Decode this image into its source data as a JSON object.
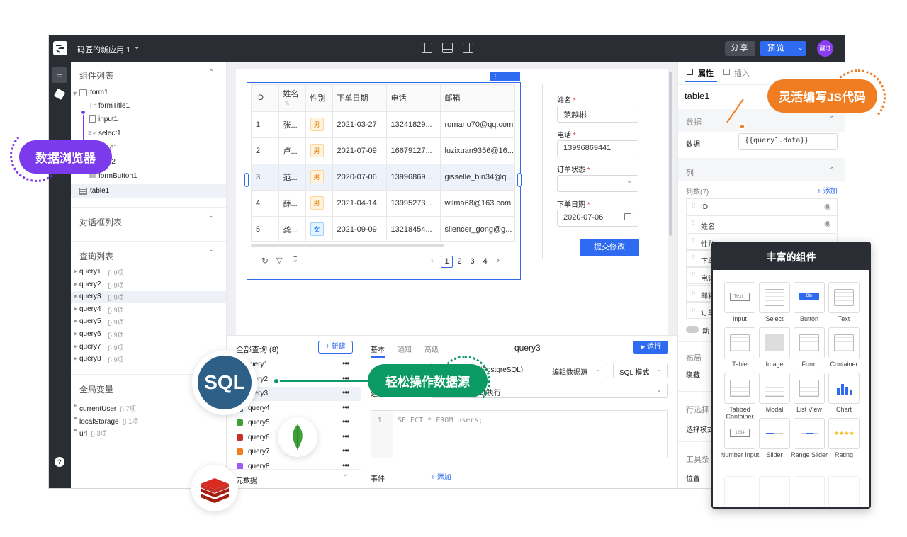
{
  "topbar": {
    "app_name": "码匠的新应用 1",
    "share_label": "分享",
    "preview_label": "预览",
    "avatar_text": "醒汀"
  },
  "leftpanel": {
    "components_title": "组件列表",
    "tree": [
      {
        "label": "form1"
      },
      {
        "label": "formTitle1"
      },
      {
        "label": "input1"
      },
      {
        "label": "select1"
      },
      {
        "label": "input2"
      },
      {
        "label": "input3"
      },
      {
        "label": "formButton1"
      },
      {
        "label": "table1"
      }
    ],
    "tree_visible_suffix": {
      "input2": "e1",
      "input3": "ut2"
    },
    "dialogs_title": "对话框列表",
    "queries_title": "查询列表",
    "queries": [
      {
        "name": "query1",
        "meta": "{} 9项"
      },
      {
        "name": "query2",
        "meta": "{} 9项"
      },
      {
        "name": "query3",
        "meta": "{} 9项"
      },
      {
        "name": "query4",
        "meta": "{} 9项"
      },
      {
        "name": "query5",
        "meta": "{} 9项"
      },
      {
        "name": "query6",
        "meta": "{} 9项"
      },
      {
        "name": "query7",
        "meta": "{} 9项"
      },
      {
        "name": "query8",
        "meta": "{} 9项"
      }
    ],
    "globals_title": "全局变量",
    "globals": [
      {
        "name": "currentUser",
        "meta": "{} 7项"
      },
      {
        "name": "localStorage",
        "meta": "{} 1项"
      },
      {
        "name": "url",
        "meta": "{} 3项"
      }
    ]
  },
  "table": {
    "badge": "table1",
    "headers": [
      "ID",
      "姓名",
      "性别",
      "下单日期",
      "电话",
      "邮箱"
    ],
    "rows": [
      [
        "1",
        "张...",
        "男",
        "2021-03-27",
        "13241829...",
        "romario70@qq.com"
      ],
      [
        "2",
        "卢...",
        "男",
        "2021-07-09",
        "16679127...",
        "luzixuan9356@16..."
      ],
      [
        "3",
        "范...",
        "男",
        "2020-07-06",
        "13996869...",
        "gisselle_bin34@q..."
      ],
      [
        "4",
        "薛...",
        "男",
        "2021-04-14",
        "13995273...",
        "wilma68@163.com"
      ],
      [
        "5",
        "龚...",
        "女",
        "2021-09-09",
        "13218454...",
        "silencer_gong@g..."
      ]
    ],
    "pages": [
      "1",
      "2",
      "3",
      "4"
    ]
  },
  "form": {
    "name_label": "姓名",
    "name_value": "范越彬",
    "phone_label": "电话",
    "phone_value": "13996869441",
    "status_label": "订单状态",
    "date_label": "下单日期",
    "date_value": "2020-07-06",
    "submit_label": "提交修改",
    "required_mark": "*"
  },
  "querypanel": {
    "all_title": "全部查询 (8)",
    "new_label": "+ 新建",
    "items": [
      "query1",
      "query2",
      "query3",
      "query4",
      "query5",
      "query6",
      "query7",
      "query8"
    ],
    "visible_items": [
      "uery1",
      "uery2",
      "uery3",
      "query4",
      "query5",
      "query6",
      "query7",
      "query8"
    ],
    "meta_label": "元数据",
    "tabs": [
      "基本",
      "通知",
      "高级"
    ],
    "current_query": "query3",
    "run_label": "运行",
    "datasource_text": "(PostgreSQL)",
    "edit_ds_label": "编辑数据源",
    "mode_label": "SQL 模式",
    "trigger_text": "动执行",
    "line_no": "1",
    "sql": "SELECT * FROM users;",
    "events_label": "事件",
    "add_label": "+ 添加",
    "row_label_cut": "选"
  },
  "rightpanel": {
    "tab_props": "属性",
    "tab_insert": "插入",
    "component_name": "table1",
    "data_section": "数据",
    "data_label": "数据",
    "data_value": "{{query1.data}}",
    "columns_section": "列",
    "columns_count_label": "列数(7)",
    "add_label": "+ 添加",
    "columns": [
      "ID",
      "姓名",
      "性别",
      "下单",
      "电话",
      "邮箱",
      "订单"
    ],
    "columns_visible": [
      "ID",
      "姓名",
      "性别",
      "下单",
      "电话",
      "邮箱",
      "订单"
    ],
    "dynamic_label": "动",
    "layout_section": "布局",
    "hidden_label": "隐藏",
    "rowselect_section": "行选择",
    "select_mode_label": "选择模式",
    "toolbar_section": "工具条",
    "position_label": "位置"
  },
  "callouts": {
    "data_browser": "数据浏览器",
    "js_code": "灵活编写JS代码",
    "datasource": "轻松操作数据源",
    "sql_badge": "SQL"
  },
  "components_popup": {
    "title": "丰富的组件",
    "items": [
      {
        "label": "Input",
        "icon": "input-icon"
      },
      {
        "label": "Select",
        "icon": "select-icon"
      },
      {
        "label": "Button",
        "icon": "button-icon"
      },
      {
        "label": "Text",
        "icon": "text-icon"
      },
      {
        "label": "Table",
        "icon": "table-icon"
      },
      {
        "label": "Image",
        "icon": "image-icon"
      },
      {
        "label": "Form",
        "icon": "form-icon"
      },
      {
        "label": "Container",
        "icon": "container-icon"
      },
      {
        "label": "Tabbed Container",
        "icon": "tabbed-container-icon"
      },
      {
        "label": "Modal",
        "icon": "modal-icon"
      },
      {
        "label": "List View",
        "icon": "list-view-icon"
      },
      {
        "label": "Chart",
        "icon": "chart-icon"
      },
      {
        "label": "Number Input",
        "icon": "number-input-icon"
      },
      {
        "label": "Slider",
        "icon": "slider-icon"
      },
      {
        "label": "Range Slider",
        "icon": "range-slider-icon"
      },
      {
        "label": "Rating",
        "icon": "rating-icon"
      }
    ],
    "card_texts": {
      "input": "Text",
      "button": "Btn",
      "number": "1234"
    }
  },
  "colors": {
    "accent": "#2f6bf0",
    "purple": "#7c3aed",
    "orange": "#f07d22",
    "green": "#0b9a63",
    "dark": "#2a2d34"
  }
}
